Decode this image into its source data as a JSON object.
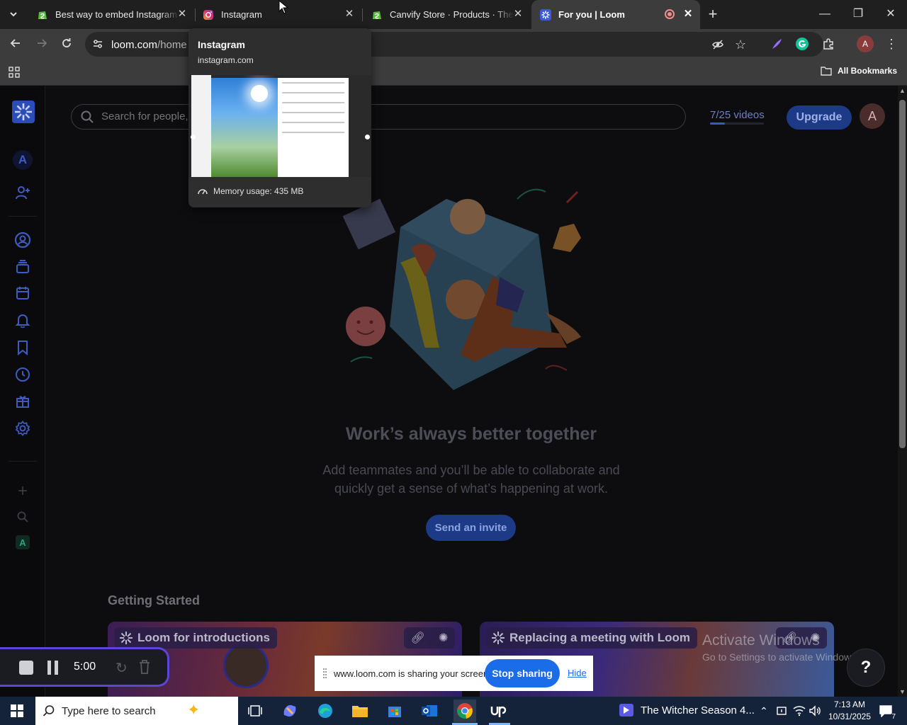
{
  "browser": {
    "tabs": [
      {
        "title": "Best way to embed Instagram",
        "icon": "shopify-icon",
        "active": false
      },
      {
        "title": "Instagram",
        "icon": "instagram-icon",
        "active": false
      },
      {
        "title": "Canvify Store · Products · The V",
        "icon": "shopify-icon",
        "active": false
      },
      {
        "title": "For you | Loom",
        "icon": "loom-icon",
        "active": true,
        "recording": true
      }
    ],
    "url_host": "loom.com",
    "url_path": "/home",
    "profile_initial": "A",
    "bookmarks_label": "All Bookmarks"
  },
  "tab_hover_card": {
    "title": "Instagram",
    "domain": "instagram.com",
    "memory": "Memory usage: 435 MB"
  },
  "loom": {
    "search_placeholder": "Search for people,",
    "videos_count": "7/25 videos",
    "videos_used_fraction": 0.28,
    "upgrade_label": "Upgrade",
    "avatar_initial": "A",
    "workspace_initial": "A",
    "workspace_initial_small": "A",
    "headline": "Work’s always better together",
    "subtext_line1": "Add teammates and you’ll be able to collaborate and",
    "subtext_line2": "quickly get a sense of what’s happening at work.",
    "invite_label": "Send an invite",
    "section_title": "Getting Started",
    "cards": [
      {
        "title": "Loom for introductions"
      },
      {
        "title": "Replacing a meeting with Loom"
      }
    ],
    "help_label": "?"
  },
  "recorder": {
    "time": "5:00"
  },
  "share_bar": {
    "text": "www.loom.com is sharing your screen.",
    "stop_label": "Stop sharing",
    "hide_label": "Hide"
  },
  "watermark": {
    "line1": "Activate Windows",
    "line2": "Go to Settings to activate Windows."
  },
  "taskbar": {
    "search_placeholder": "Type here to search",
    "media_title": "The Witcher Season 4...",
    "time": "7:13 AM",
    "date": "10/31/2025",
    "notification_count": "7"
  },
  "colors": {
    "loom_blue": "#1c3a86",
    "share_blue": "#1a6ce8",
    "recorder_border": "#5a46d8"
  }
}
